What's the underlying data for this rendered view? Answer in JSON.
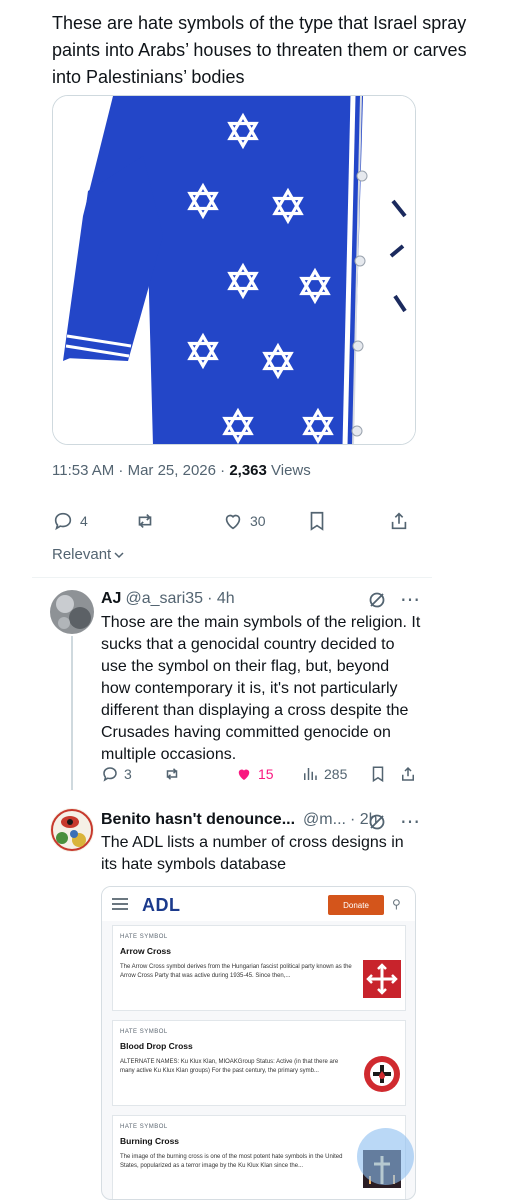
{
  "tweet": {
    "text": "These are hate symbols of the type that Israel spray paints into Arabs’ houses to threaten them or carves into Palestinians’ bodies",
    "time": "11:53 AM · Mar 25, 2026 · ",
    "views_count": "2,363",
    "views_label": " Views",
    "actions": {
      "replies": "4",
      "likes": "30"
    },
    "sort_label": "Relevant"
  },
  "replies": [
    {
      "name": "AJ",
      "handle": "@a_sari35",
      "time": "· 4h",
      "text": "Those are the main symbols of the religion. It sucks that a genocidal country decided to use the symbol on their flag, but, beyond how contemporary it is, it's not particularly different than displaying a cross despite the Crusades having committed genocide on multiple occasions.",
      "replies": "3",
      "likes": "15",
      "views": "285"
    },
    {
      "name": "Benito hasn't denounce...",
      "handle": "@m...",
      "time": "· 2h",
      "text": "The ADL lists a number of cross designs in its hate symbols database"
    }
  ],
  "adl": {
    "logo": "ADL",
    "donate": "Donate",
    "cards": [
      {
        "kicker": "HATE SYMBOL",
        "title": "Arrow Cross",
        "desc": "The Arrow Cross symbol derives from the Hungarian fascist political party known as the Arrow Cross Party that was active during 1935-45. Since then,..."
      },
      {
        "kicker": "HATE SYMBOL",
        "title": "Blood Drop Cross",
        "desc": "ALTERNATE NAMES: Ku Klux Klan, MIOAKGroup Status: Active (in that there are many active Ku Klux Klan groups) For the past century, the primary symb..."
      },
      {
        "kicker": "HATE SYMBOL",
        "title": "Burning Cross",
        "desc": "The image of the burning cross is one of the most potent hate symbols in the United States, popularized as a terror image by the Ku Klux Klan since the..."
      }
    ]
  },
  "colors": {
    "jersey_blue": "#2346c8",
    "like_pink": "#f91880",
    "secondary_text": "#536471",
    "adl_orange": "#d4551b"
  }
}
